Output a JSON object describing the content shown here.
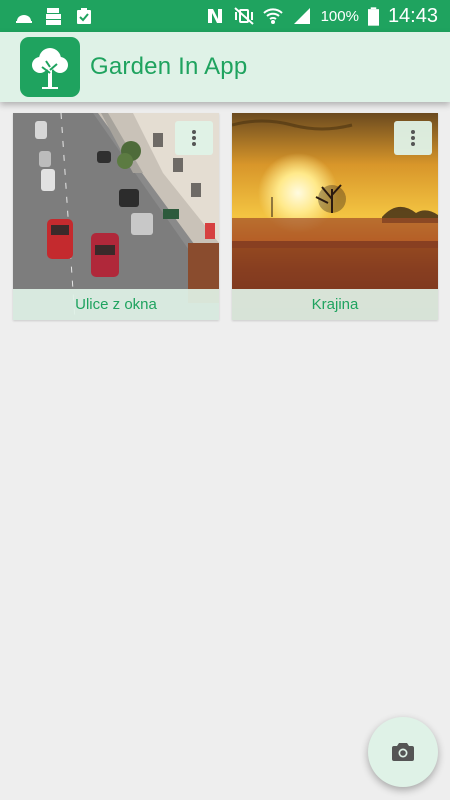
{
  "status_bar": {
    "battery_percent": "100%",
    "time": "14:43",
    "icons_left": [
      "cloud-icon",
      "stack-icon",
      "clipboard-check-icon"
    ],
    "icons_right": [
      "nfc-icon",
      "vibrate-icon",
      "wifi-icon",
      "signal-icon",
      "battery-icon"
    ]
  },
  "app_bar": {
    "title": "Garden In App",
    "logo_icon": "tree-icon"
  },
  "albums": [
    {
      "caption": "Ulice z okna",
      "menu_icon": "more-vert-icon"
    },
    {
      "caption": "Krajina",
      "menu_icon": "more-vert-icon"
    }
  ],
  "fab": {
    "icon": "camera-icon"
  },
  "colors": {
    "primary": "#1fa35f",
    "primary_light": "#dff2e7",
    "background": "#eeeeee"
  }
}
